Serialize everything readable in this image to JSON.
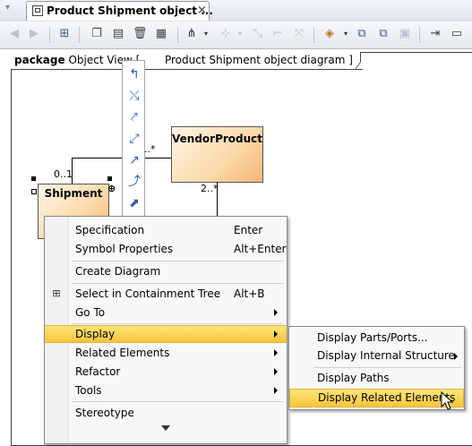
{
  "tab": {
    "title": "Product Shipment object ...",
    "close_glyph": "×",
    "icon": "object-diagram-icon"
  },
  "toolbar": {
    "icons": [
      "back-arrow-icon",
      "forward-arrow-icon",
      "select-in-tree-icon",
      "copy-icon",
      "paste-icon",
      "delete-icon",
      "delete-from-model-icon",
      "layout-icon",
      "route-icon",
      "connector-icon",
      "align-icon",
      "fill-color-icon",
      "add-element-icon",
      "add-child-icon",
      "lock-icon",
      "next-icon",
      "more-icon"
    ]
  },
  "frame": {
    "kind": "package",
    "label": "Object View [",
    "diagram_name": "Product Shipment object diagram ]"
  },
  "diagram": {
    "vendor_product": "VendorProduct",
    "shipment": "Shipment",
    "mult_shipment_top": "0..1",
    "mult_vendor_left": "..*",
    "mult_vendor_bottom": "2..*"
  },
  "context_menu": {
    "items": [
      {
        "label": "Specification",
        "shortcut": "Enter"
      },
      {
        "label": "Symbol Properties",
        "shortcut": "Alt+Enter"
      },
      {
        "label": "Create Diagram"
      },
      {
        "label": "Select in Containment Tree",
        "shortcut": "Alt+B",
        "icon": "containment-tree-icon"
      },
      {
        "label": "Go To",
        "submenu": true
      },
      {
        "label": "Display",
        "submenu": true,
        "highlighted": true
      },
      {
        "label": "Related Elements",
        "submenu": true
      },
      {
        "label": "Refactor",
        "submenu": true
      },
      {
        "label": "Tools",
        "submenu": true
      },
      {
        "label": "Stereotype"
      }
    ]
  },
  "display_submenu": {
    "items": [
      {
        "label": "Display Parts/Ports..."
      },
      {
        "label": "Display Internal Structure",
        "submenu": true
      },
      {
        "label": "Display Paths"
      },
      {
        "label": "Display Related Elements",
        "highlighted": true
      }
    ]
  }
}
